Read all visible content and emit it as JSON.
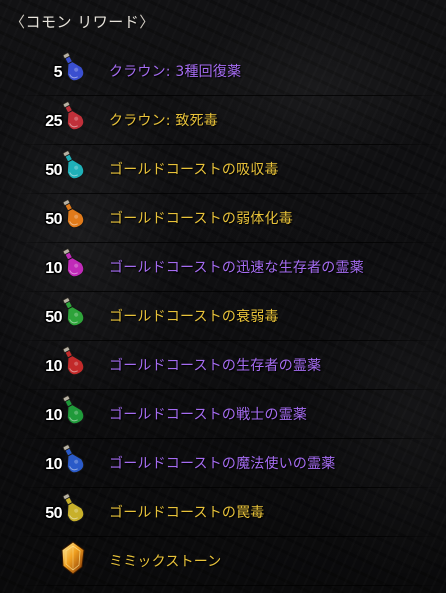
{
  "header": {
    "bracket_open": "〈",
    "title": "コモン リワード",
    "bracket_close": "〉"
  },
  "rewards": [
    {
      "name": "クラウン: 3種回復薬",
      "qty": "5",
      "rarity_color": "purple",
      "icon": "blue-tri-potion-icon",
      "liquid": "#3a4fd0"
    },
    {
      "name": "クラウン: 致死毒",
      "qty": "25",
      "rarity_color": "gold",
      "icon": "red-poison-vial-icon",
      "liquid": "#c0303a"
    },
    {
      "name": "ゴールドコーストの吸収毒",
      "qty": "50",
      "rarity_color": "gold",
      "icon": "teal-poison-vial-icon",
      "liquid": "#1fb0b8"
    },
    {
      "name": "ゴールドコーストの弱体化毒",
      "qty": "50",
      "rarity_color": "gold",
      "icon": "orange-poison-vial-icon",
      "liquid": "#e07a1a"
    },
    {
      "name": "ゴールドコーストの迅速な生存者の霊薬",
      "qty": "10",
      "rarity_color": "purple",
      "icon": "magenta-potion-icon",
      "liquid": "#c02ab8"
    },
    {
      "name": "ゴールドコーストの衰弱毒",
      "qty": "50",
      "rarity_color": "gold",
      "icon": "green-poison-vial-icon",
      "liquid": "#2ea33a"
    },
    {
      "name": "ゴールドコーストの生存者の霊薬",
      "qty": "10",
      "rarity_color": "purple",
      "icon": "red-potion-icon",
      "liquid": "#c22a2a"
    },
    {
      "name": "ゴールドコーストの戦士の霊薬",
      "qty": "10",
      "rarity_color": "purple",
      "icon": "green-potion-icon",
      "liquid": "#1f9a3a"
    },
    {
      "name": "ゴールドコーストの魔法使いの霊薬",
      "qty": "10",
      "rarity_color": "purple",
      "icon": "blue-potion-icon",
      "liquid": "#2a5ac8"
    },
    {
      "name": "ゴールドコーストの罠毒",
      "qty": "50",
      "rarity_color": "gold",
      "icon": "yellow-poison-vial-icon",
      "liquid": "#c8b02a"
    },
    {
      "name": "ミミックストーン",
      "qty": "",
      "rarity_color": "gold",
      "icon": "mimic-stone-icon",
      "liquid": "#f0a020"
    }
  ],
  "colors": {
    "purple": "#a56cf2",
    "gold": "#e9c33a",
    "background": "#0e0e10"
  }
}
